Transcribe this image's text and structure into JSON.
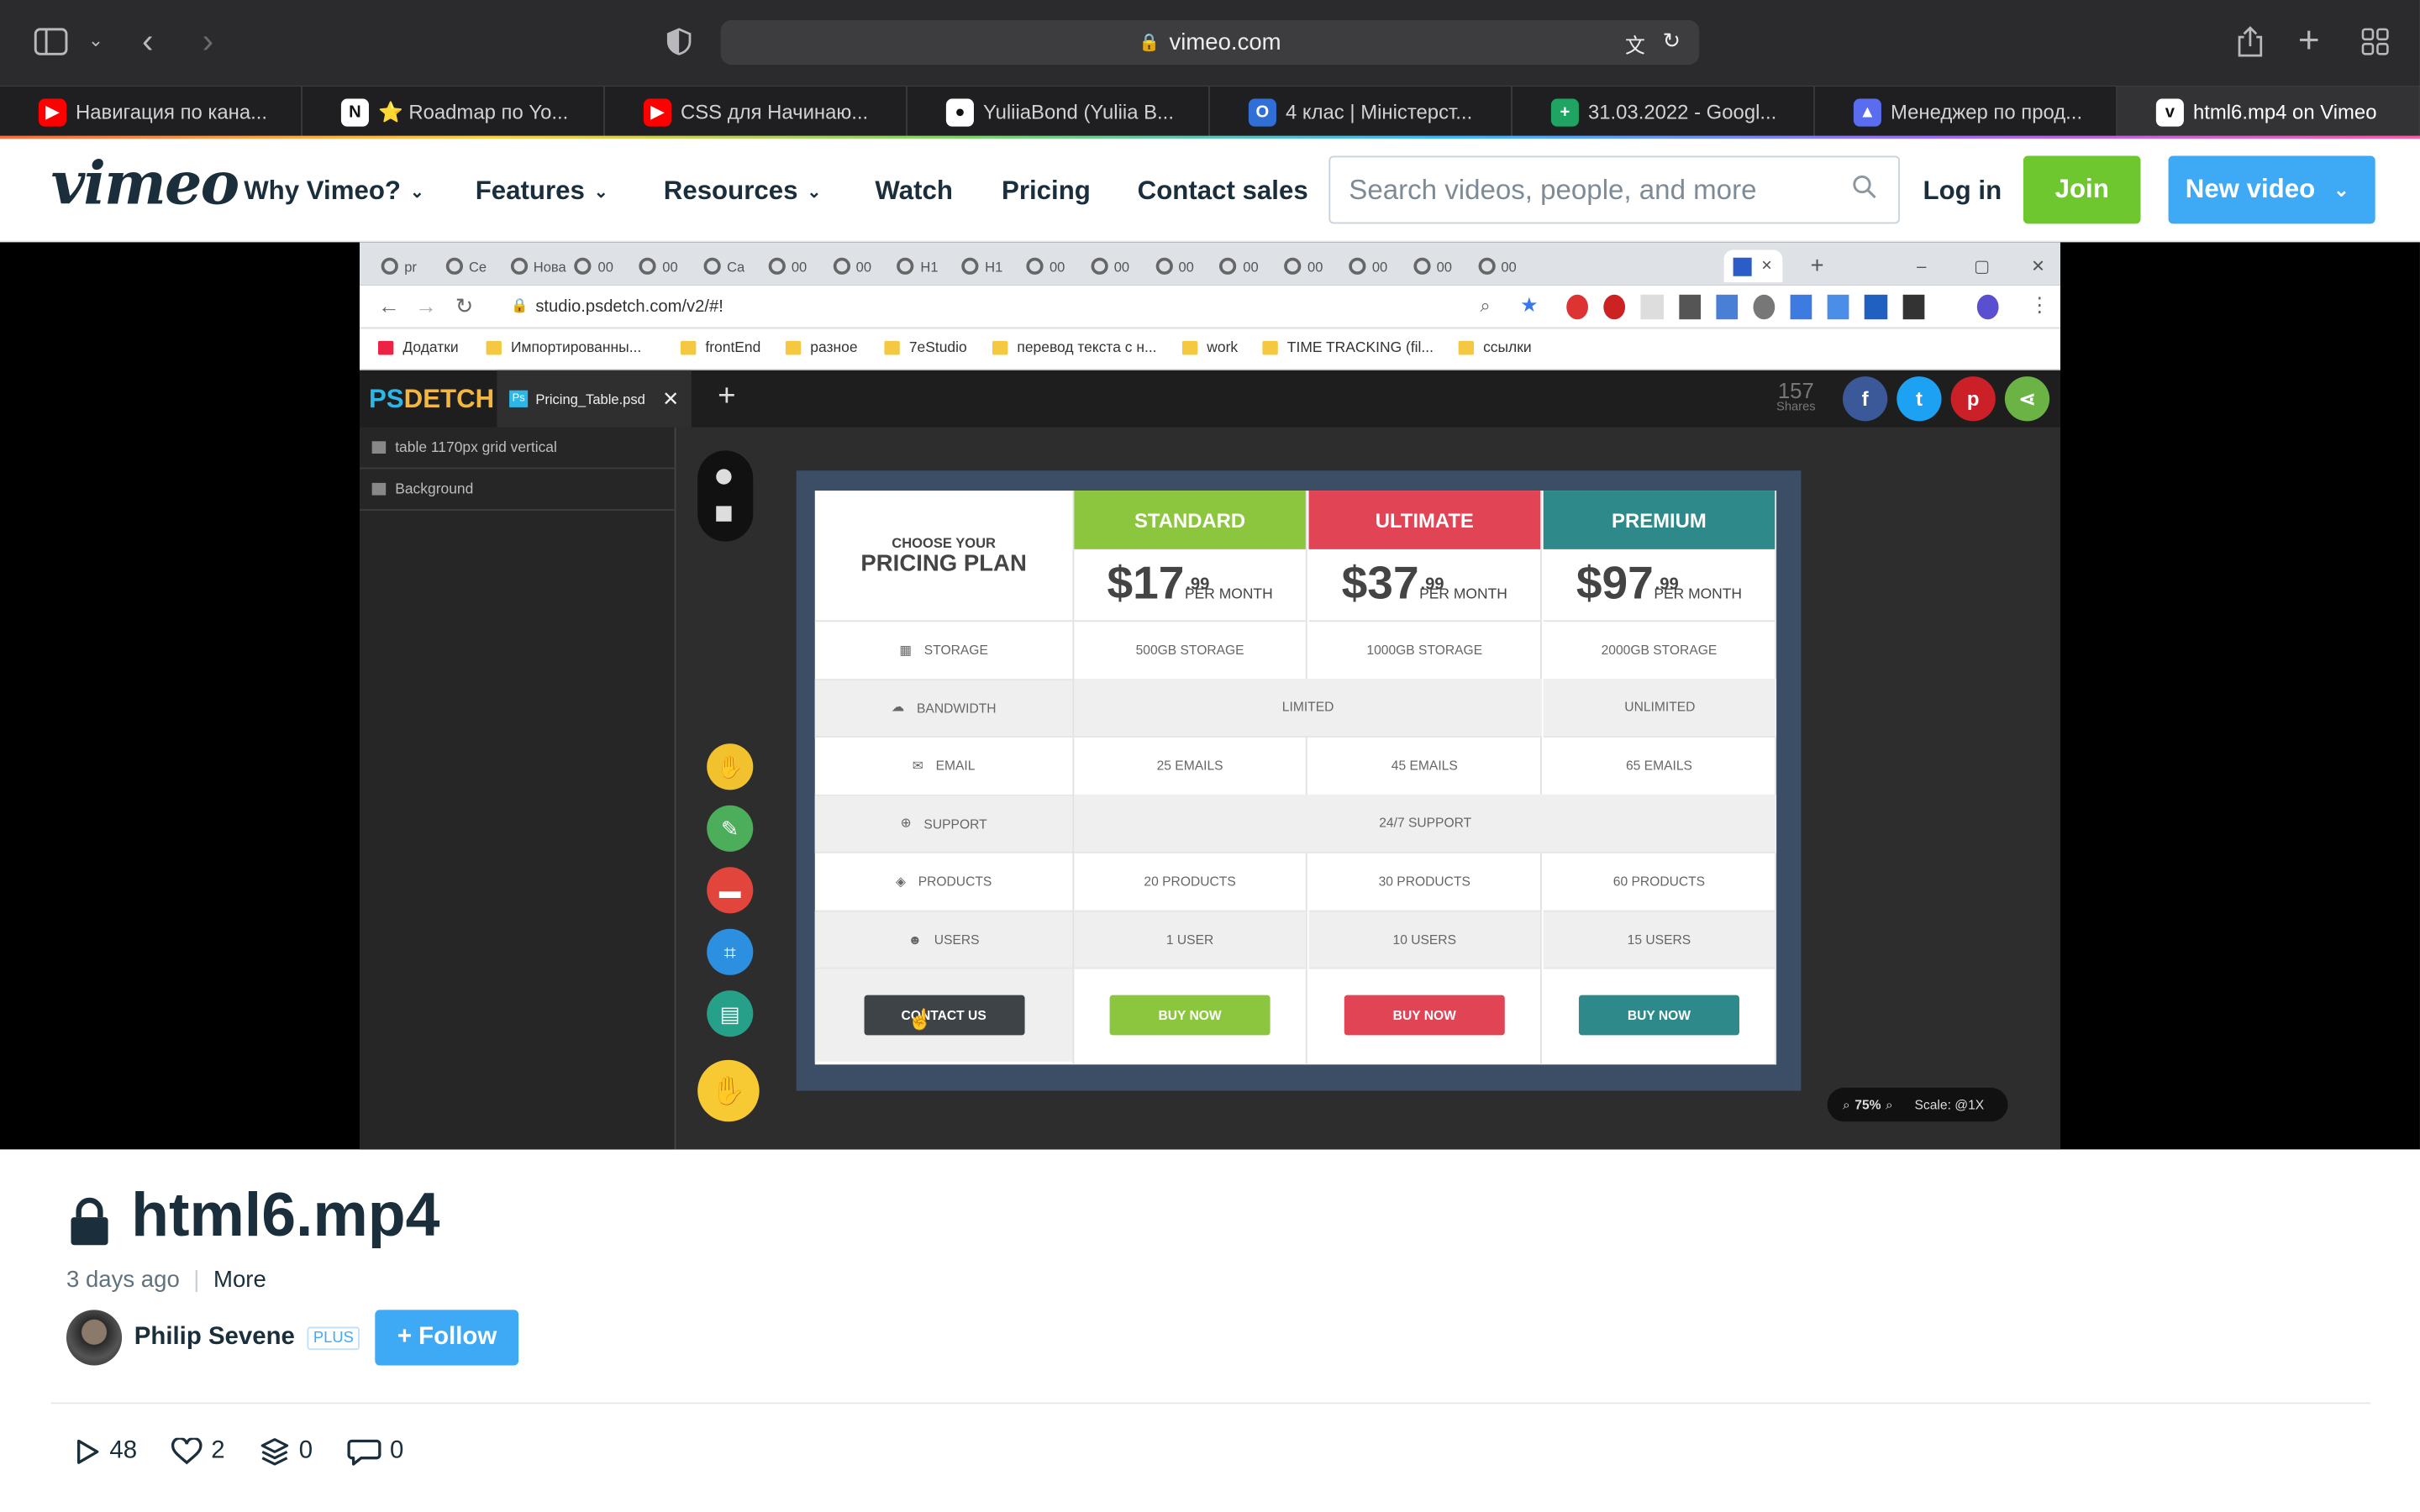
{
  "browser": {
    "url": "vimeo.com",
    "tabs": [
      {
        "label": "Навигация по кана...",
        "icon": "youtube-icon",
        "color": "#ff0000"
      },
      {
        "label": "⭐ Roadmap по Yo...",
        "icon": "notion-icon",
        "color": "#ffffff"
      },
      {
        "label": "CSS для Начинаю...",
        "icon": "youtube-icon",
        "color": "#ff0000"
      },
      {
        "label": "YuliiaBond (Yuliia B...",
        "icon": "github-icon",
        "color": "#ffffff"
      },
      {
        "label": "4 клас | Міністерст...",
        "icon": "outlook-icon",
        "color": "#2f6fd6"
      },
      {
        "label": "31.03.2022 - Googl...",
        "icon": "sheets-icon",
        "color": "#1fa463"
      },
      {
        "label": "Менеджер по прод...",
        "icon": "triangle-logo-icon",
        "color": "#5a6cf0"
      },
      {
        "label": "html6.mp4 on Vimeo",
        "icon": "vimeo-icon",
        "color": "#ffffff"
      }
    ]
  },
  "header": {
    "logo": "vimeo",
    "nav": [
      "Why Vimeo?",
      "Features",
      "Resources",
      "Watch",
      "Pricing",
      "Contact sales"
    ],
    "search_placeholder": "Search videos, people, and more",
    "login": "Log in",
    "join": "Join",
    "new_video": "New video"
  },
  "video_content": {
    "inner_tab_labels": [
      "pr",
      "Ce",
      "Нова",
      "00",
      "00",
      "Ca",
      "00",
      "00",
      "H1",
      "H1",
      "00",
      "00",
      "00",
      "00",
      "00",
      "00",
      "00",
      "00"
    ],
    "inner_url": "studio.psdetch.com/v2/#!",
    "bookmarks": [
      "Додатки",
      "Импортированны...",
      "frontEnd",
      "разное",
      "7eStudio",
      "перевод текста с н...",
      "work",
      "TIME TRACKING (fil...",
      "ссылки"
    ],
    "psdetch_logo": {
      "a": "PS",
      "b": "DETCH"
    },
    "psd_tab": "Pricing_Table.psd",
    "shares_count": "157",
    "shares_label": "Shares",
    "layers": [
      "table 1170px grid vertical",
      "Background"
    ],
    "pricing": {
      "heading_small": "CHOOSE YOUR",
      "heading_big": "PRICING PLAN",
      "features": [
        "STORAGE",
        "BANDWIDTH",
        "EMAIL",
        "SUPPORT",
        "PRODUCTS",
        "USERS"
      ],
      "contact_button": "CONTACT US",
      "plans": [
        {
          "name": "STANDARD",
          "color": "#8cc63f",
          "price": "$17",
          "cents": ".99",
          "per": "PER MONTH",
          "storage": "500GB STORAGE",
          "email": "25 EMAILS",
          "products": "20 PRODUCTS",
          "users": "1 USER",
          "button": "BUY NOW"
        },
        {
          "name": "ULTIMATE",
          "color": "#e04455",
          "price": "$37",
          "cents": ".99",
          "per": "PER MONTH",
          "storage": "1000GB STORAGE",
          "email": "45 EMAILS",
          "products": "30 PRODUCTS",
          "users": "10 USERS",
          "button": "BUY NOW"
        },
        {
          "name": "PREMIUM",
          "color": "#2e8a8a",
          "price": "$97",
          "cents": ".99",
          "per": "PER MONTH",
          "storage": "2000GB STORAGE",
          "email": "65 EMAILS",
          "products": "60 PRODUCTS",
          "users": "15 USERS",
          "button": "BUY NOW"
        }
      ],
      "bandwidth_shared": "LIMITED",
      "bandwidth_premium": "UNLIMITED",
      "support_shared": "24/7 SUPPORT"
    },
    "zoom": "75%",
    "scale": "Scale: @1X"
  },
  "video": {
    "title": "html6.mp4",
    "posted": "3 days ago",
    "more": "More",
    "owner": "Philip Sevene",
    "badge": "PLUS",
    "follow": "+ Follow",
    "plays": "48",
    "likes": "2",
    "collections": "0",
    "comments": "0"
  }
}
